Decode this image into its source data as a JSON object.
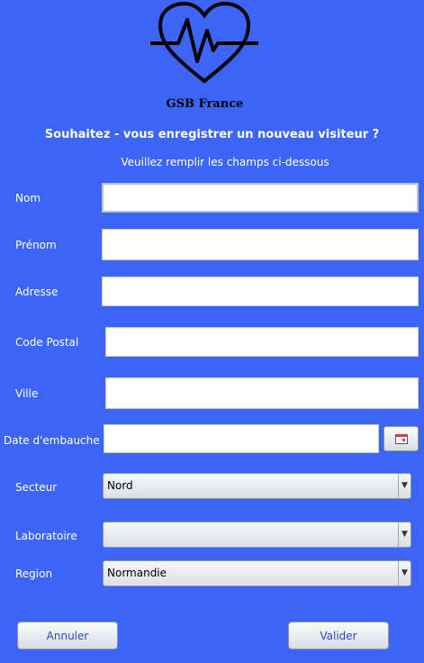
{
  "app": {
    "brand": "GSB France"
  },
  "header": {
    "headline": "Souhaitez - vous enregistrer un nouveau visiteur ?",
    "instructions": "Veuillez remplir les champs ci-dessous"
  },
  "form": {
    "nom": {
      "label": "Nom",
      "value": ""
    },
    "prenom": {
      "label": "Prénom",
      "value": ""
    },
    "adresse": {
      "label": "Adresse",
      "value": ""
    },
    "code_postal": {
      "label": "Code Postal",
      "value": ""
    },
    "ville": {
      "label": "Ville",
      "value": ""
    },
    "date_embauche": {
      "label": "Date d'embauche",
      "value": ""
    },
    "secteur": {
      "label": "Secteur",
      "value": "Nord"
    },
    "laboratoire": {
      "label": "Laboratoire",
      "value": ""
    },
    "region": {
      "label": "Region",
      "value": "Normandie"
    }
  },
  "actions": {
    "cancel": "Annuler",
    "submit": "Valider"
  },
  "icons": {
    "logo": "heart-pulse-icon",
    "calendar": "calendar-icon",
    "dropdown": "chevron-down-icon"
  },
  "colors": {
    "background": "#3d65f5",
    "button_text": "#2a4bc2"
  }
}
